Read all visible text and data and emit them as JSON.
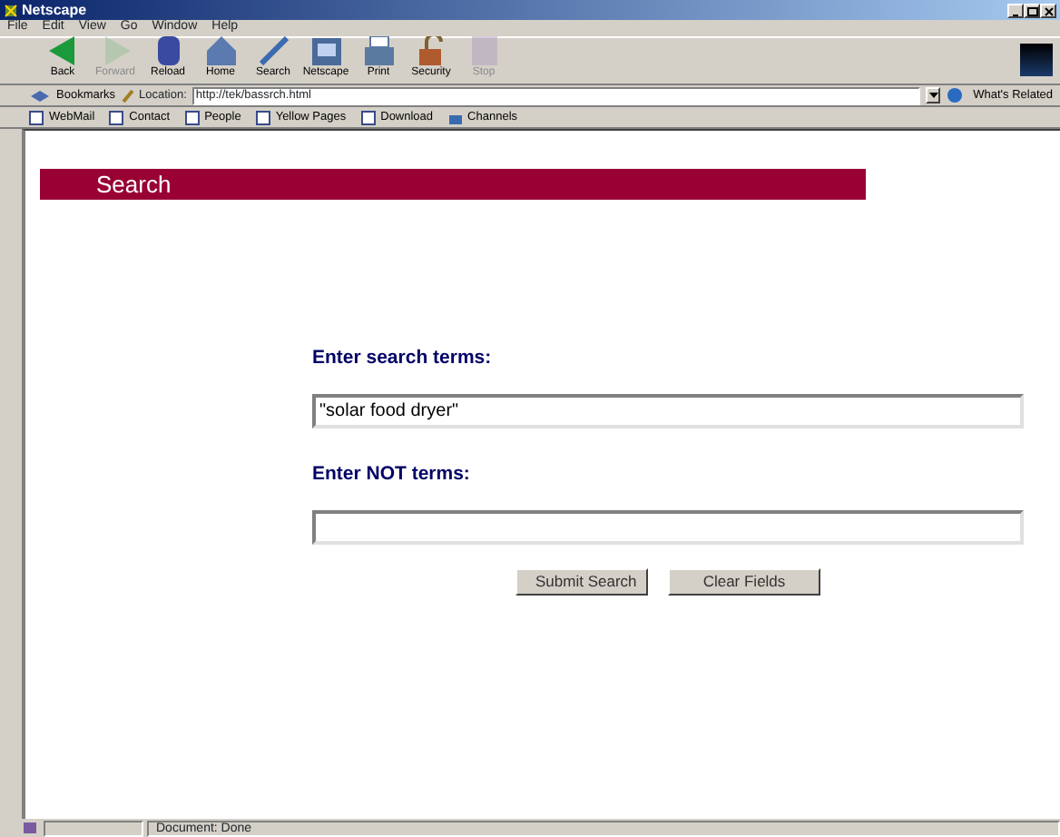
{
  "window": {
    "title": "Netscape"
  },
  "menu": [
    "File",
    "Edit",
    "View",
    "Go",
    "Window",
    "Help"
  ],
  "toolbar": [
    {
      "label": "Back",
      "disabled": false,
      "kind": "back"
    },
    {
      "label": "Forward",
      "disabled": true,
      "kind": "forward"
    },
    {
      "label": "Reload",
      "disabled": false,
      "kind": "reload"
    },
    {
      "label": "Home",
      "disabled": false,
      "kind": "home"
    },
    {
      "label": "Search",
      "disabled": false,
      "kind": "search"
    },
    {
      "label": "Netscape",
      "disabled": false,
      "kind": "netscape"
    },
    {
      "label": "Print",
      "disabled": false,
      "kind": "print"
    },
    {
      "label": "Security",
      "disabled": false,
      "kind": "security"
    },
    {
      "label": "Stop",
      "disabled": true,
      "kind": "stop"
    }
  ],
  "location_bar": {
    "bookmarks": "Bookmarks",
    "label": "Location:",
    "url": "http://tek/bassrch.html",
    "related": "What's Related"
  },
  "personal_toolbar": [
    {
      "label": "WebMail",
      "kind": "page"
    },
    {
      "label": "Contact",
      "kind": "page"
    },
    {
      "label": "People",
      "kind": "page"
    },
    {
      "label": "Yellow Pages",
      "kind": "page"
    },
    {
      "label": "Download",
      "kind": "page"
    },
    {
      "label": "Channels",
      "kind": "channel"
    }
  ],
  "page": {
    "banner": "Search",
    "fields": [
      {
        "label": "Enter search terms:",
        "value": "\"solar food dryer\""
      },
      {
        "label": "Enter NOT terms:"
      }
    ],
    "buttons": [
      "Submit Search",
      "Clear Fields"
    ]
  },
  "status_bar": {
    "text": "Document: Done"
  }
}
